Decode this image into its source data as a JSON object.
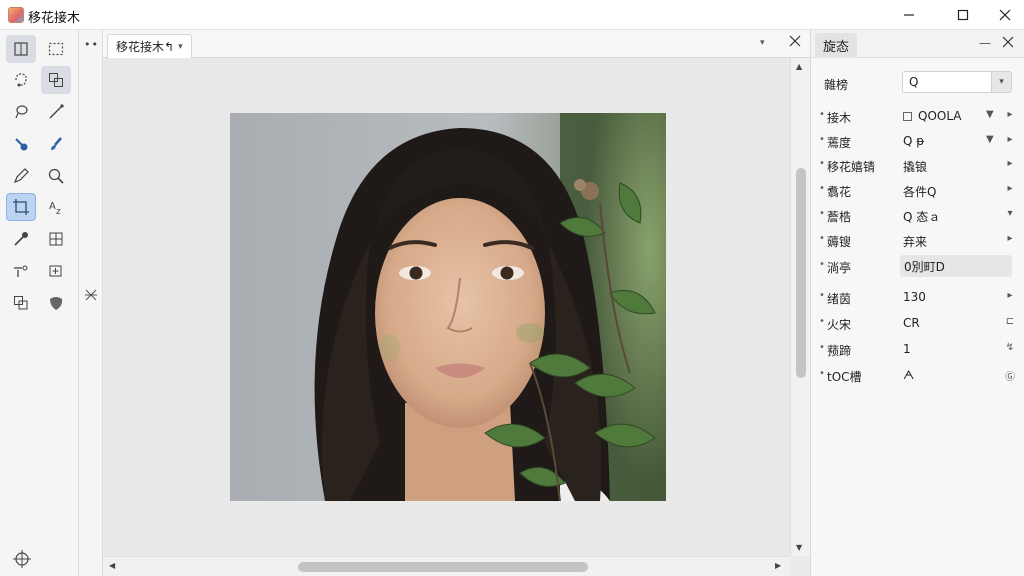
{
  "window": {
    "title": "移花接木",
    "controls": {
      "minimize": "—",
      "maximize": "□",
      "close": "✕"
    }
  },
  "toolbox": {
    "tools": [
      {
        "icon": "move-icon",
        "state": "active"
      },
      {
        "icon": "rect-select-icon",
        "state": ""
      },
      {
        "icon": "lasso-select-icon",
        "state": ""
      },
      {
        "icon": "object-select-icon",
        "state": "active"
      },
      {
        "icon": "lasso-icon",
        "state": ""
      },
      {
        "icon": "line-tool-icon",
        "state": ""
      },
      {
        "icon": "heal-icon",
        "state": ""
      },
      {
        "icon": "brush-icon",
        "state": ""
      },
      {
        "icon": "pencil-icon",
        "state": ""
      },
      {
        "icon": "magnifier-icon",
        "state": ""
      },
      {
        "icon": "crop-tool-icon",
        "state": "selected"
      },
      {
        "icon": "text-tool-icon",
        "state": ""
      },
      {
        "icon": "eyedropper-icon",
        "state": ""
      },
      {
        "icon": "transform-icon",
        "state": ""
      },
      {
        "icon": "path-tool-icon",
        "state": ""
      },
      {
        "icon": "add-anchor-icon",
        "state": ""
      },
      {
        "icon": "shape-tool-icon",
        "state": ""
      },
      {
        "icon": "blob-tool-icon",
        "state": ""
      }
    ],
    "bottom_icon": "target-icon"
  },
  "strip": {
    "dots": "••"
  },
  "document": {
    "tab_label": "移花接木↰",
    "tab_caret": "▾",
    "tab_menu": "▾"
  },
  "panel": {
    "tab_label": "旋态",
    "minimize": "—",
    "top": {
      "label": "雜榜",
      "value": "Q",
      "button": "▾"
    },
    "rows": [
      {
        "label": "接木",
        "value": "QOOLA",
        "has_icon": true,
        "ctrl2": "▼",
        "ctrl": "▸"
      },
      {
        "label": "蔫度",
        "value": "Q ᵽ",
        "has_icon": false,
        "ctrl2": "▼",
        "ctrl": "▸"
      },
      {
        "label": "移花嬉锖",
        "value": "撬锒",
        "has_icon": false,
        "ctrl2": "",
        "ctrl": "▸"
      },
      {
        "label": "翥花",
        "value": "各件Q",
        "has_icon": false,
        "ctrl2": "",
        "ctrl": "▸"
      },
      {
        "label": "薝梏",
        "value": "Q 态ａ",
        "has_icon": false,
        "ctrl2": "",
        "ctrl": "▾"
      },
      {
        "label": "薅锼",
        "value": "弃来",
        "has_icon": false,
        "ctrl2": "",
        "ctrl": "▸"
      },
      {
        "label": "淌亭",
        "value": "0別町D",
        "has_icon": false,
        "boxed": true,
        "ctrl2": "",
        "ctrl": ""
      },
      {
        "label": "绪茵",
        "value": "130",
        "has_icon": false,
        "ctrl2": "",
        "ctrl": "▸"
      },
      {
        "label": "火宋",
        "value": "CR",
        "has_icon": false,
        "ctrl2": "",
        "ctrl": "⊏"
      },
      {
        "label": "蓣蹄",
        "value": "1",
        "has_icon": false,
        "ctrl2": "",
        "ctrl": "↯"
      },
      {
        "label": "tOC槽",
        "value": "ᗅ",
        "has_icon": false,
        "ctrl2": "",
        "ctrl": "Ⓖ"
      }
    ]
  },
  "colors": {
    "selected_tool": "#bcd4f2",
    "panel_bg": "#f7f7f7",
    "canvas_bg": "#e9e9e9"
  }
}
